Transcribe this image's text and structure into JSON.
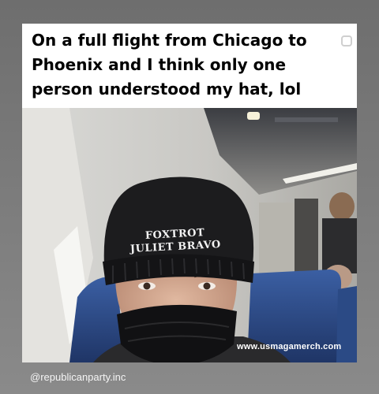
{
  "post": {
    "caption": "On a full flight from Chicago to Phoenix and I think only one person understood my hat, lol",
    "hat_text_line1": "FOXTROT",
    "hat_text_line2": "JULIET BRAVO",
    "watermark": "www.usmagamerch.com"
  },
  "footer": {
    "handle": "@republicanparty.inc"
  },
  "colors": {
    "background": "#7a7a7a",
    "card": "#ffffff",
    "caption_text": "#000000",
    "seat_blue": "#2e4f8c",
    "beanie": "#1c1c1e"
  },
  "icons": {
    "select_box": "checkbox-icon"
  }
}
